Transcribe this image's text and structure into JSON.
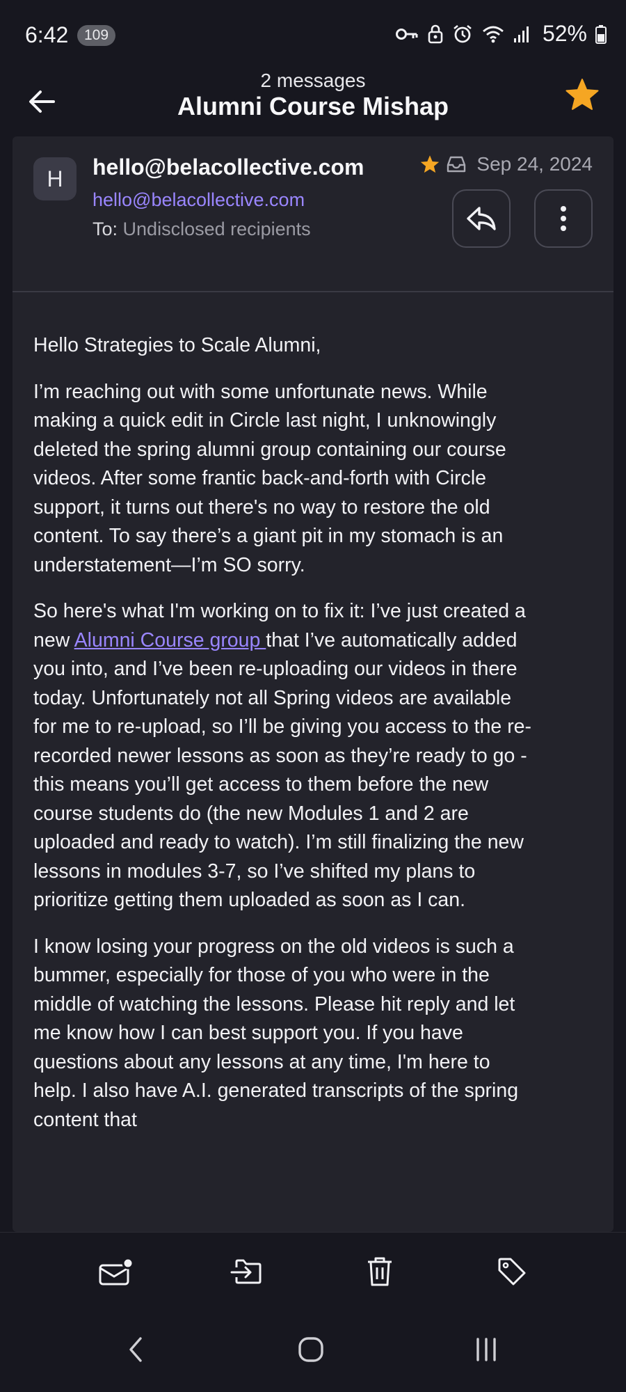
{
  "status_bar": {
    "time": "6:42",
    "notification_count": "109",
    "battery_percent": "52%",
    "icons": [
      "vpn-key-icon",
      "lock-icon",
      "alarm-icon",
      "wifi-icon",
      "signal-icon",
      "battery-icon"
    ]
  },
  "header": {
    "message_count": "2 messages",
    "title": "Alumni Course Mishap",
    "starred": true
  },
  "email": {
    "avatar_letter": "H",
    "sender_name": "hello@belacollective.com",
    "sender_email": "hello@belacollective.com",
    "to_label": "To:",
    "to_value": "Undisclosed recipients",
    "date": "Sep 24, 2024",
    "body": {
      "greeting": "Hello Strategies to Scale Alumni,",
      "p1": "I’m reaching out with some unfortunate news. While making a quick edit in Circle last night, I unknowingly deleted the spring alumni group containing our course videos. After some frantic back-and-forth with Circle support, it turns out there's no way to restore the old content. To say there’s a giant pit in my stomach is an understatement—I’m SO sorry.",
      "p2_before": "So here's what I'm working on to fix it: I’ve just created a new ",
      "p2_link": "Alumni Course group ",
      "p2_after": "that I’ve automatically added you into, and I’ve been re-uploading our videos in there today. Unfortunately not all Spring videos are available for me to re-upload, so I’ll be giving you access to the re-recorded newer lessons as soon as they’re ready to go - this means you’ll get access to them before the new course students do (the new Modules 1 and 2 are uploaded and ready to watch). I’m still finalizing the new lessons in modules 3-7, so I’ve shifted my plans to prioritize getting them uploaded as soon as I can.",
      "p3": "I know losing your progress on the old videos is such a bummer, especially for those of you who were in the middle of watching the lessons. Please hit reply and let me know how I can best support you. If you have questions about any lessons at any time, I'm here to help. I also have A.I. generated transcripts of the spring content that"
    }
  },
  "toolbar": {
    "icons": [
      "mark-unread-icon",
      "move-to-folder-icon",
      "delete-icon",
      "label-icon"
    ]
  },
  "nav": {
    "icons": [
      "back-nav-icon",
      "home-nav-icon",
      "recents-nav-icon"
    ]
  },
  "colors": {
    "background": "#17171f",
    "card": "#23232b",
    "accent": "#9a86ff",
    "star": "#f5a623"
  }
}
